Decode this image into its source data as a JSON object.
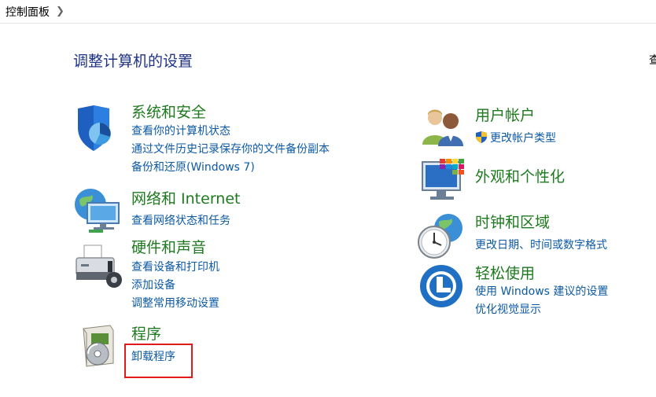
{
  "breadcrumb": {
    "item": "控制面板"
  },
  "page_title": "调整计算机的设置",
  "view_by_label": "查",
  "categories": {
    "system": {
      "title": "系统和安全",
      "links": [
        "查看你的计算机状态",
        "通过文件历史记录保存你的文件备份副本",
        "备份和还原(Windows 7)"
      ]
    },
    "network": {
      "title": "网络和 Internet",
      "links": [
        "查看网络状态和任务"
      ]
    },
    "hardware": {
      "title": "硬件和声音",
      "links": [
        "查看设备和打印机",
        "添加设备",
        "调整常用移动设置"
      ]
    },
    "programs": {
      "title": "程序",
      "links": [
        "卸载程序"
      ]
    },
    "users": {
      "title": "用户帐户",
      "links": [
        "更改帐户类型"
      ]
    },
    "appearance": {
      "title": "外观和个性化",
      "links": []
    },
    "clock": {
      "title": "时钟和区域",
      "links": [
        "更改日期、时间或数字格式"
      ]
    },
    "ease": {
      "title": "轻松使用",
      "links": [
        "使用 Windows 建议的设置",
        "优化视觉显示"
      ]
    }
  },
  "colors": {
    "title_green": "#1e7a1e",
    "link_blue": "#0c5aa6",
    "heading_blue": "#1e3287",
    "highlight_red": "#e0191b"
  }
}
